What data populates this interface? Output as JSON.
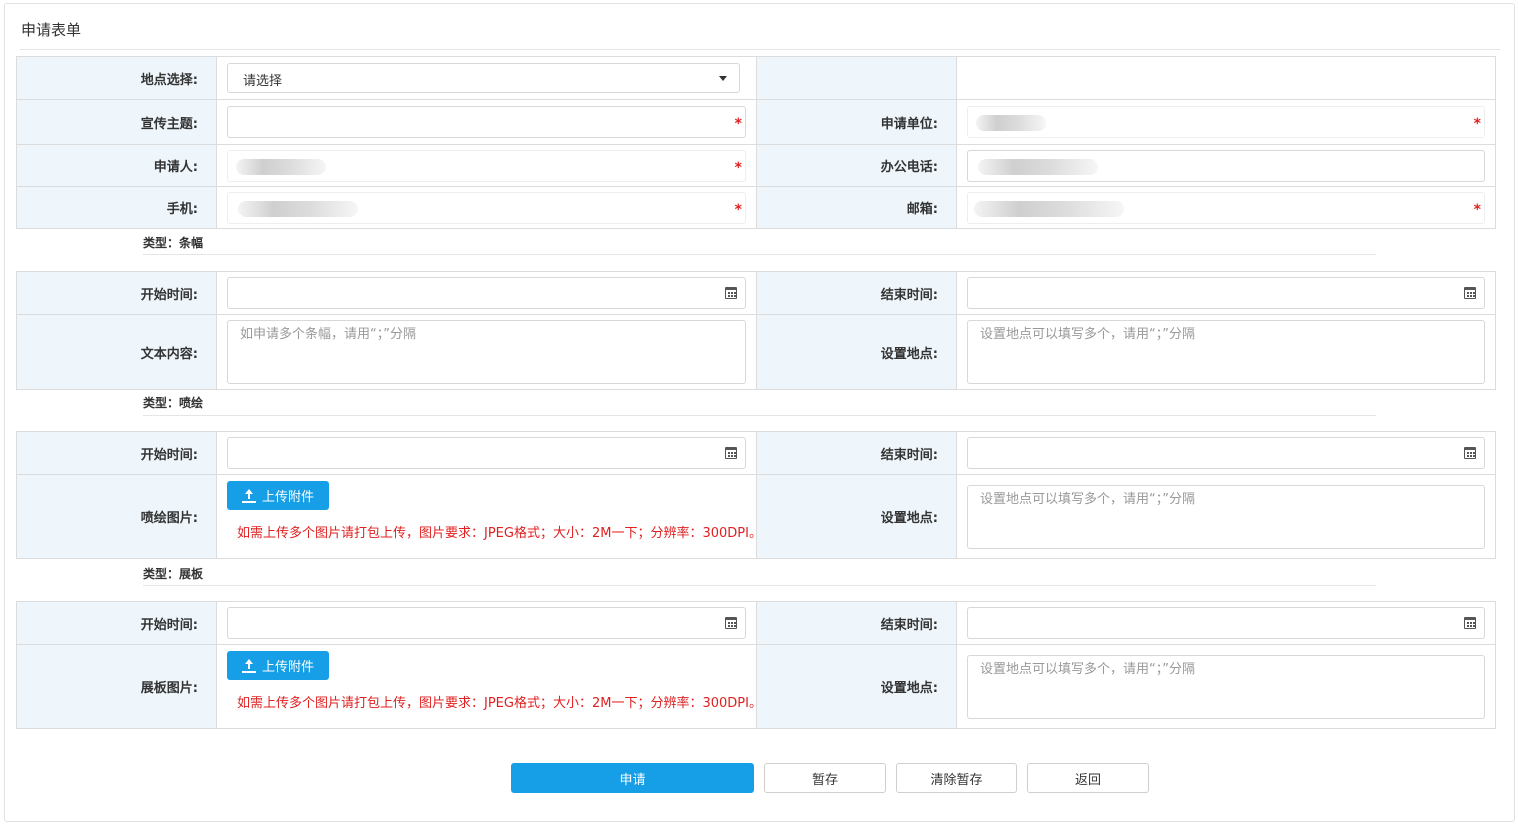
{
  "title": "申请表单",
  "basic": {
    "location_label": "地点选择:",
    "location_value": "请选择",
    "theme_label": "宣传主题:",
    "unit_label": "申请单位:",
    "applicant_label": "申请人:",
    "office_phone_label": "办公电话:",
    "mobile_label": "手机:",
    "email_label": "邮箱:",
    "required_mark": "*"
  },
  "sections": [
    {
      "heading": "类型：条幅",
      "start_label": "开始时间:",
      "end_label": "结束时间:",
      "content_label": "文本内容:",
      "content_placeholder": "如申请多个条幅，请用“；”分隔",
      "place_label": "设置地点:",
      "place_placeholder": "设置地点可以填写多个，请用“；”分隔"
    },
    {
      "heading": "类型：喷绘",
      "start_label": "开始时间:",
      "end_label": "结束时间:",
      "image_label": "喷绘图片:",
      "upload_label": "上传附件",
      "note": "如需上传多个图片请打包上传，图片要求：JPEG格式；大小：2M一下；分辨率：300DPI。",
      "place_label": "设置地点:",
      "place_placeholder": "设置地点可以填写多个，请用“；”分隔"
    },
    {
      "heading": "类型：展板",
      "start_label": "开始时间:",
      "end_label": "结束时间:",
      "image_label": "展板图片:",
      "upload_label": "上传附件",
      "note": "如需上传多个图片请打包上传，图片要求：JPEG格式；大小：2M一下；分辨率：300DPI。",
      "place_label": "设置地点:",
      "place_placeholder": "设置地点可以填写多个，请用“；”分隔"
    }
  ],
  "actions": {
    "submit": "申请",
    "save_draft": "暂存",
    "clear_draft": "清除暂存",
    "back": "返回"
  },
  "colors": {
    "accent": "#169fe6",
    "label_bg": "#eef6fb",
    "required": "#e02020"
  }
}
